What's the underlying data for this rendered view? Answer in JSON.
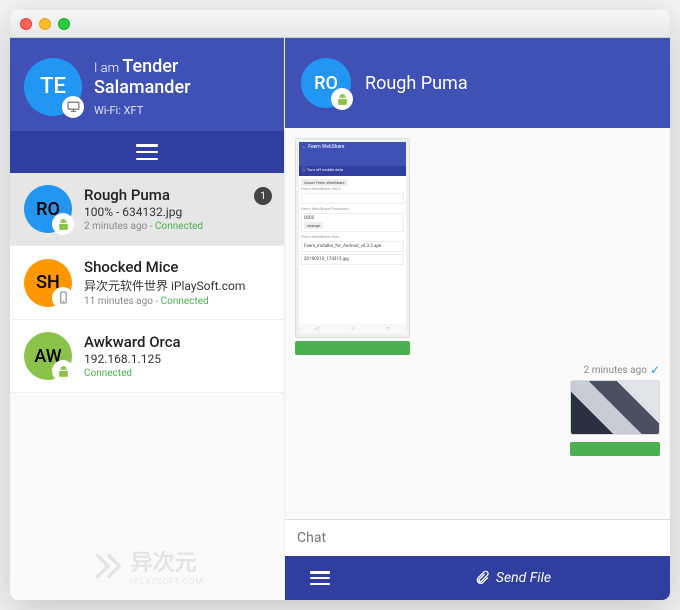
{
  "profile": {
    "initials": "TE",
    "iam_prefix": "I am",
    "name": "Tender Salamander",
    "wifi": "Wi-Fi: XFT"
  },
  "peers": [
    {
      "initials": "RO",
      "name": "Rough Puma",
      "sub": "100% - 634132.jpg",
      "time": "2 minutes ago",
      "status": "Connected",
      "badge": "1",
      "device": "android"
    },
    {
      "initials": "SH",
      "name": "Shocked Mice",
      "sub": "异次元软件世界 iPlaySoft.com",
      "time": "11 minutes ago",
      "status": "Connected",
      "device": "phone"
    },
    {
      "initials": "AW",
      "name": "Awkward Orca",
      "sub": "192.168.1.125",
      "time": "",
      "status": "Connected",
      "device": "android"
    }
  ],
  "chat": {
    "header_initials": "RO",
    "header_name": "Rough Puma",
    "msg_right_time": "2 minutes ago",
    "input_placeholder": "Chat",
    "send_label": "Send File"
  },
  "phone_preview": {
    "title": "← Feem WebShare",
    "hint": "Turn off mobile data",
    "tab": "About Feem WebShare",
    "url_label": "Feem WebShare URLS",
    "pw_label": "Feem WebShare Password",
    "pw_value": "0000",
    "change": "change",
    "files_label": "Feem WebShare Files",
    "file1": "Feem_Installer_for_Android_v4.3.2.apk",
    "file2": "20190210_174312.jpg"
  },
  "watermark": {
    "text": "异次元",
    "sub": "IPLAYSOFT.COM"
  }
}
